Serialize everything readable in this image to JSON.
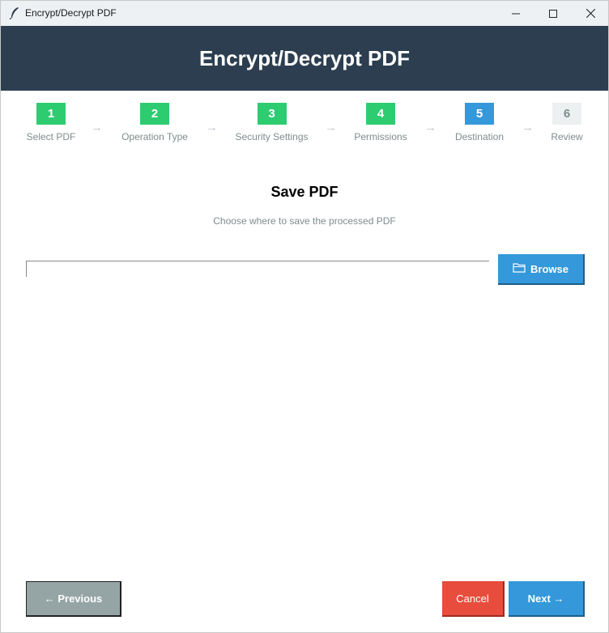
{
  "window": {
    "title": "Encrypt/Decrypt PDF",
    "app_icon": "feather-icon"
  },
  "header": {
    "title": "Encrypt/Decrypt PDF",
    "background": "#2c3e50"
  },
  "steps": [
    {
      "number": "1",
      "label": "Select PDF",
      "state": "done"
    },
    {
      "number": "2",
      "label": "Operation Type",
      "state": "done"
    },
    {
      "number": "3",
      "label": "Security Settings",
      "state": "done"
    },
    {
      "number": "4",
      "label": "Permissions",
      "state": "done"
    },
    {
      "number": "5",
      "label": "Destination",
      "state": "active"
    },
    {
      "number": "6",
      "label": "Review",
      "state": "pending"
    }
  ],
  "step_arrow": "→",
  "content": {
    "title": "Save PDF",
    "subtitle": "Choose where to save the processed PDF",
    "path_value": "",
    "browse_label": "Browse",
    "browse_icon": "folder-icon"
  },
  "footer": {
    "previous_label": "← Previous",
    "cancel_label": "Cancel",
    "next_label": "Next →"
  },
  "colors": {
    "done": "#2ecc71",
    "active": "#3498db",
    "pending": "#ecf0f1",
    "cancel": "#e74c3c",
    "previous": "#95a5a6"
  }
}
